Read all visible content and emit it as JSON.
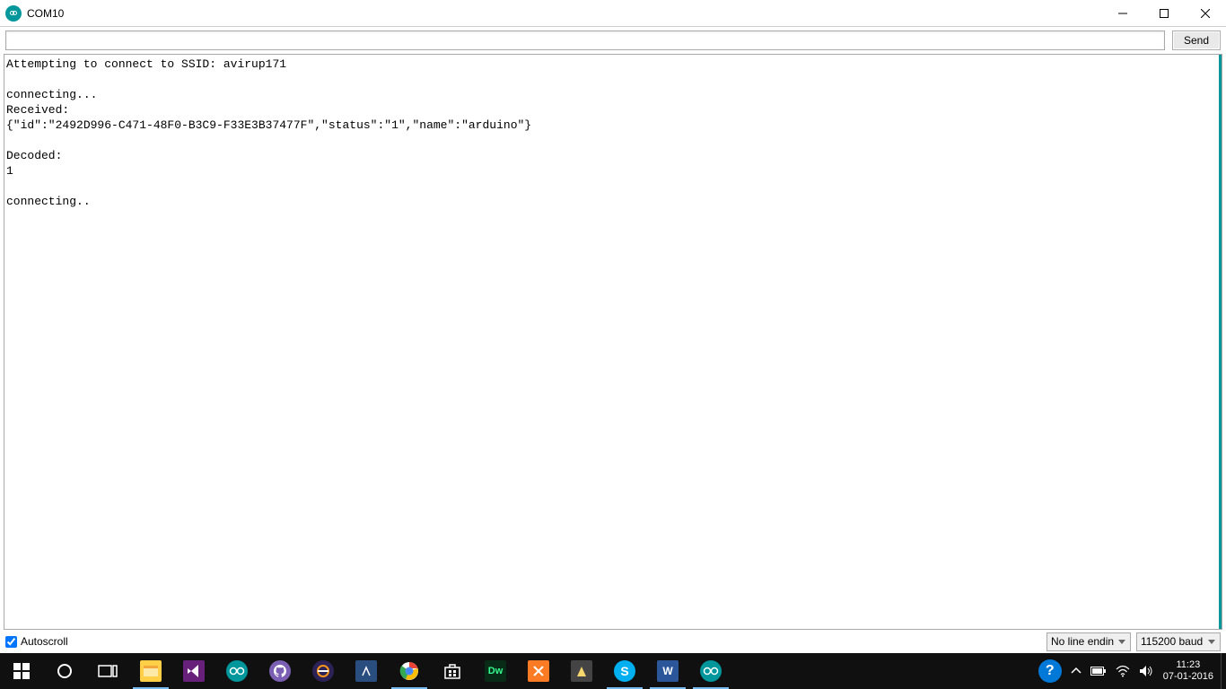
{
  "window_title": "COM10",
  "input_value": "",
  "send_label": "Send",
  "output_lines": [
    "Attempting to connect to SSID: avirup171",
    "",
    "connecting...",
    "Received:",
    "{\"id\":\"2492D996-C471-48F0-B3C9-F33E3B37477F\",\"status\":\"1\",\"name\":\"arduino\"}",
    "",
    "Decoded:",
    "1",
    "",
    "connecting.."
  ],
  "autoscroll_label": "Autoscroll",
  "autoscroll_checked": true,
  "line_ending_selected": "No line ending",
  "baud_selected": "115200 baud",
  "clock_time": "11:23",
  "clock_date": "07-01-2016"
}
